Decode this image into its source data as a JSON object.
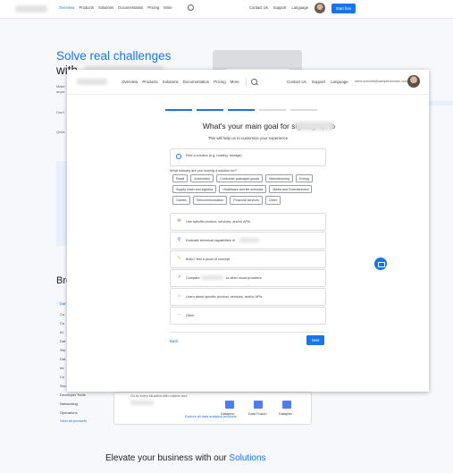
{
  "background": {
    "nav": [
      "Overview",
      "Products",
      "Solutions",
      "Documentation",
      "Pricing",
      "More"
    ],
    "right_links": [
      "Contact Us",
      "Support",
      "Language"
    ],
    "start_button": "Start free",
    "hero_title": "Solve real challenges",
    "hero_with": "with",
    "hero_line_a": "Make",
    "hero_line_b": "anyw",
    "hero_dont": "Don't",
    "hero_ques": "Ques",
    "browse_heading": "Bro",
    "sidebar": [
      "Dat",
      "Co",
      "Co",
      "AI",
      "Dat",
      "Sto",
      "Dat",
      "Int",
      "Co",
      "Sec",
      "Developer Tools",
      "Networking",
      "Operations",
      "View all products"
    ],
    "box_text": "Go to every situation with custom and",
    "products": [
      "Dataproc",
      "Data Fusion",
      "Dataplex"
    ],
    "explore_link": "Explore all data analytics products",
    "elevate_text": "Elevate your business with our",
    "elevate_link": "Solutions"
  },
  "overlay": {
    "nav": [
      "Overview",
      "Products",
      "Solutions",
      "Documentation",
      "Pricing",
      "More"
    ],
    "right_links": [
      "Contact Us",
      "Support",
      "Language"
    ],
    "email": "hans.schmidt@sampledomain.com",
    "title": "What's your main goal for signing up to",
    "subtitle": "This will help us to customize your experience",
    "industry_placeholder": "Find a solution (e.g. hosting, storage)",
    "industry_question": "What industry are you looking a solution for?",
    "chips": [
      "Retail",
      "Automotive",
      "Consumer packaged goods",
      "Manufacturing",
      "Energy",
      "Supply chain and logistics",
      "Healthcare and life sciences",
      "Media and Entertainment",
      "Games",
      "Telecommunication",
      "Financial services",
      "Other"
    ],
    "options": [
      {
        "icon": "megaphone-icon",
        "label": "Use specific product, services, and/or APIs"
      },
      {
        "icon": "magnifier-icon",
        "label": "Evaluate technical capabilities of"
      },
      {
        "icon": "pencil-icon",
        "label": "Build / test a proof of concept"
      },
      {
        "icon": "compare-arrow-icon",
        "label": "Compare",
        "label_after": "to other cloud providers"
      },
      {
        "icon": "lightbulb-icon",
        "label": "Learn about specific product, services, and/or APIs"
      },
      {
        "icon": "more-horiz-icon",
        "label": "Other"
      }
    ],
    "back_label": "Back",
    "next_label": "Next"
  },
  "colors": {
    "accent": "#1a73e8",
    "progress_done": "#1a73e8",
    "progress_todo": "#dadce0"
  }
}
